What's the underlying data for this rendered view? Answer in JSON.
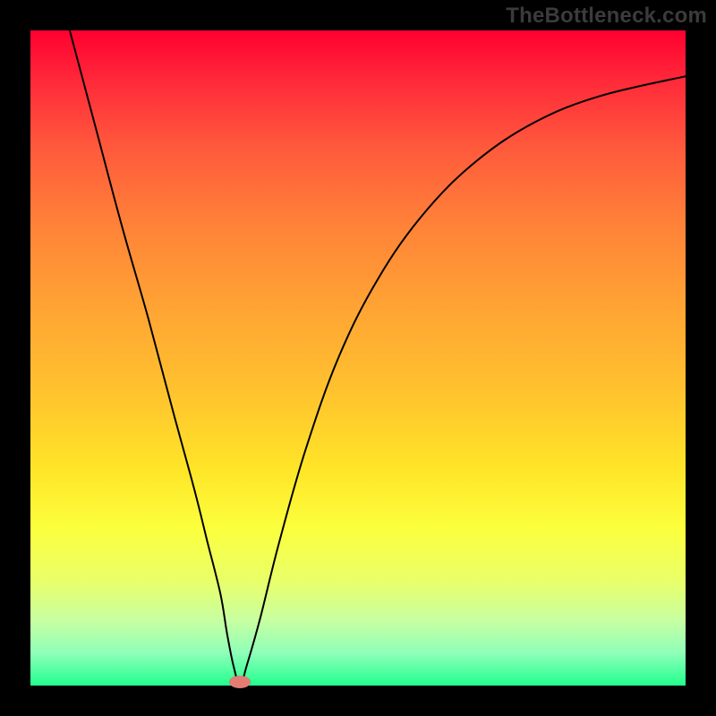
{
  "watermark": "TheBottleneck.com",
  "chart_data": {
    "type": "line",
    "title": "",
    "xlabel": "",
    "ylabel": "",
    "xlim": [
      0,
      100
    ],
    "ylim": [
      0,
      100
    ],
    "grid": false,
    "legend": false,
    "series": [
      {
        "name": "bottleneck-curve",
        "x": [
          6,
          10,
          14,
          18,
          22,
          25,
          27,
          29,
          30,
          31,
          32,
          33,
          35,
          38,
          42,
          47,
          53,
          60,
          68,
          77,
          87,
          100
        ],
        "y": [
          100,
          85,
          70,
          56,
          41,
          30,
          22,
          14,
          8,
          3,
          0,
          3,
          10,
          22,
          36,
          50,
          62,
          72,
          80,
          86,
          90,
          93
        ],
        "color": "#000000"
      }
    ],
    "annotations": [
      {
        "name": "valley-marker",
        "x": 32,
        "y": 0.5,
        "color": "#e37d74",
        "shape": "ellipse"
      }
    ],
    "background_gradient": {
      "direction": "top-to-bottom",
      "stops": [
        {
          "pos": 0.0,
          "color": "#ff0030"
        },
        {
          "pos": 0.3,
          "color": "#ff8338"
        },
        {
          "pos": 0.67,
          "color": "#ffe528"
        },
        {
          "pos": 0.9,
          "color": "#c8ffa1"
        },
        {
          "pos": 1.0,
          "color": "#21ff8d"
        }
      ]
    }
  }
}
